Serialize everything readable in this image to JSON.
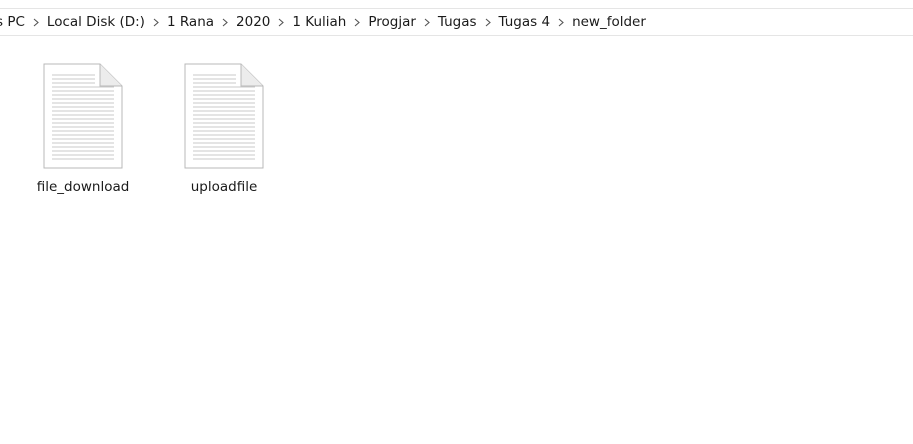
{
  "breadcrumb": {
    "items": [
      "s PC",
      "Local Disk (D:)",
      "1 Rana",
      "2020",
      "1 Kuliah",
      "Progjar",
      "Tugas",
      "Tugas 4",
      "new_folder"
    ],
    "separator_icon": "chevron-right-icon"
  },
  "files": [
    {
      "name": "file_download",
      "icon": "text-file-icon"
    },
    {
      "name": "uploadfile",
      "icon": "text-file-icon"
    }
  ]
}
